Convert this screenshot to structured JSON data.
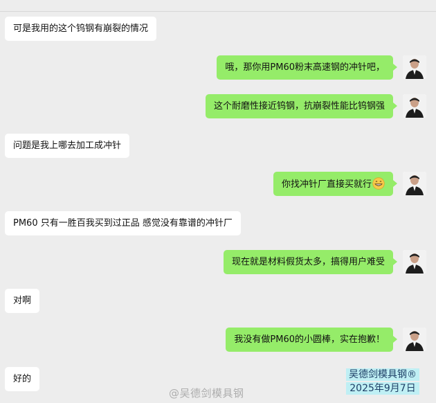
{
  "messages": [
    {
      "side": "left",
      "text": "可是我用的这个钨钢有崩裂的情况"
    },
    {
      "side": "right",
      "text": "哦，那你用PM60粉末高速钢的冲针吧，"
    },
    {
      "side": "right",
      "text": "这个耐磨性接近钨钢，抗崩裂性能比钨钢强"
    },
    {
      "side": "left",
      "text": "问题是我上哪去加工成冲针"
    },
    {
      "side": "right",
      "text": "你找冲针厂直接买就行"
    },
    {
      "side": "left",
      "text": "PM60 只有一胜百我买到过正品 感觉没有靠谱的冲针厂"
    },
    {
      "side": "right",
      "text": "现在就是材料假货太多，搞得用户难受"
    },
    {
      "side": "left",
      "text": "对啊"
    },
    {
      "side": "right",
      "text": "我没有做PM60的小圆棒，实在抱歉！"
    },
    {
      "side": "left",
      "text": "好的"
    }
  ],
  "emoji": "grin-emoji",
  "watermark": {
    "brand": "吴德剑模具钢®",
    "date": "2025年9月7日",
    "weibo": "@吴德剑模具钢"
  },
  "colors": {
    "background": "#ededed",
    "left_bubble": "#ffffff",
    "right_bubble": "#95ec69",
    "watermark_bg": "#bfeff4"
  }
}
